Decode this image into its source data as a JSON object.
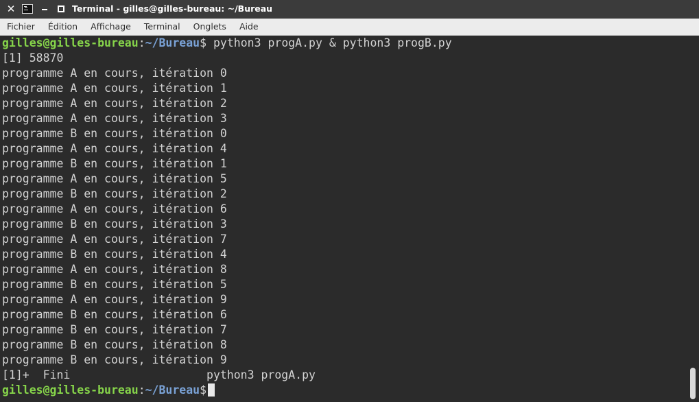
{
  "window": {
    "title": "Terminal - gilles@gilles-bureau: ~/Bureau"
  },
  "menu": [
    "Fichier",
    "Édition",
    "Affichage",
    "Terminal",
    "Onglets",
    "Aide"
  ],
  "prompt": {
    "user_host": "gilles@gilles-bureau",
    "separator": ":",
    "directory": "~/Bureau",
    "symbol": "$"
  },
  "command": " python3 progA.py & python3 progB.py",
  "output": [
    "[1] 58870",
    "programme A en cours, itération 0",
    "programme A en cours, itération 1",
    "programme A en cours, itération 2",
    "programme A en cours, itération 3",
    "programme B en cours, itération 0",
    "programme A en cours, itération 4",
    "programme B en cours, itération 1",
    "programme A en cours, itération 5",
    "programme B en cours, itération 2",
    "programme A en cours, itération 6",
    "programme B en cours, itération 3",
    "programme A en cours, itération 7",
    "programme B en cours, itération 4",
    "programme A en cours, itération 8",
    "programme B en cours, itération 5",
    "programme A en cours, itération 9",
    "programme B en cours, itération 6",
    "programme B en cours, itération 7",
    "programme B en cours, itération 8",
    "programme B en cours, itération 9",
    "[1]+  Fini                    python3 progA.py"
  ],
  "colors": {
    "background": "#2b2b2b",
    "text": "#d3d3d3",
    "prompt_user": "#86d44a",
    "prompt_dir": "#7aa2d6"
  }
}
